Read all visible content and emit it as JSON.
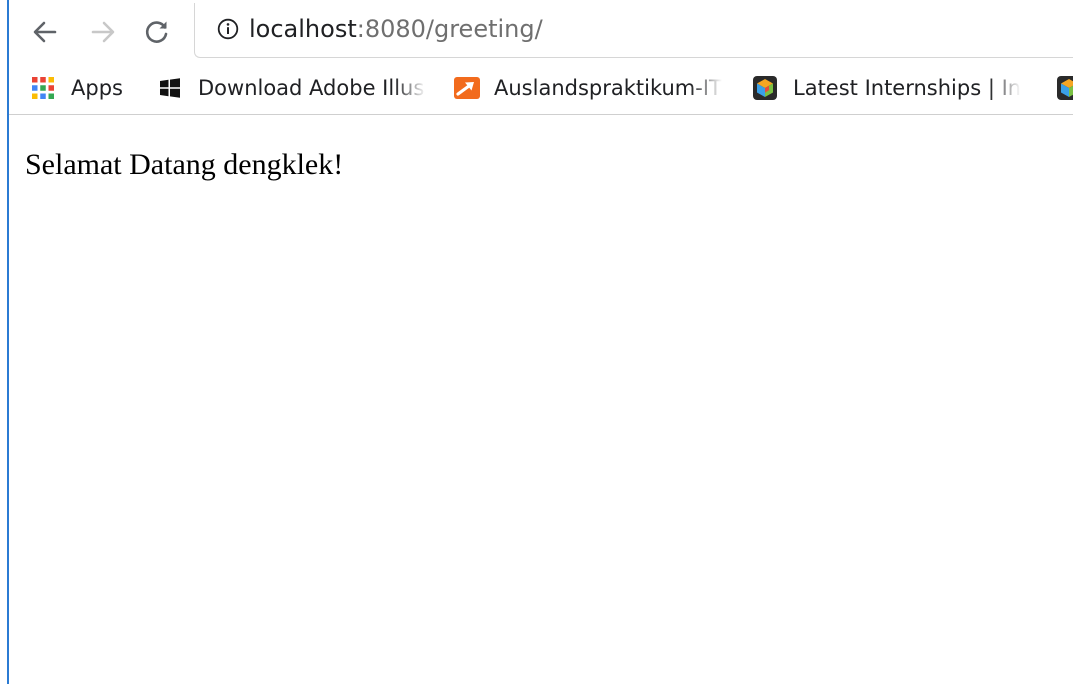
{
  "address_bar": {
    "host": "localhost",
    "path": ":8080/greeting/"
  },
  "bookmarks": [
    {
      "label": "Apps",
      "icon": "apps-grid-icon"
    },
    {
      "label": "Download Adobe Illus",
      "icon": "windows-logo-icon"
    },
    {
      "label": "Auslandspraktikum-IT",
      "icon": "orange-arrow-icon"
    },
    {
      "label": "Latest Internships | In",
      "icon": "cube-logo-icon"
    },
    {
      "label": "",
      "icon": "cube-logo-icon"
    }
  ],
  "page": {
    "greeting": "Selamat Datang dengklek!"
  },
  "colors": {
    "window_edge": "#2b7bd3",
    "url_host": "#202124",
    "url_path": "#6f6f6f",
    "adobe_icon": "#f26b1d"
  }
}
